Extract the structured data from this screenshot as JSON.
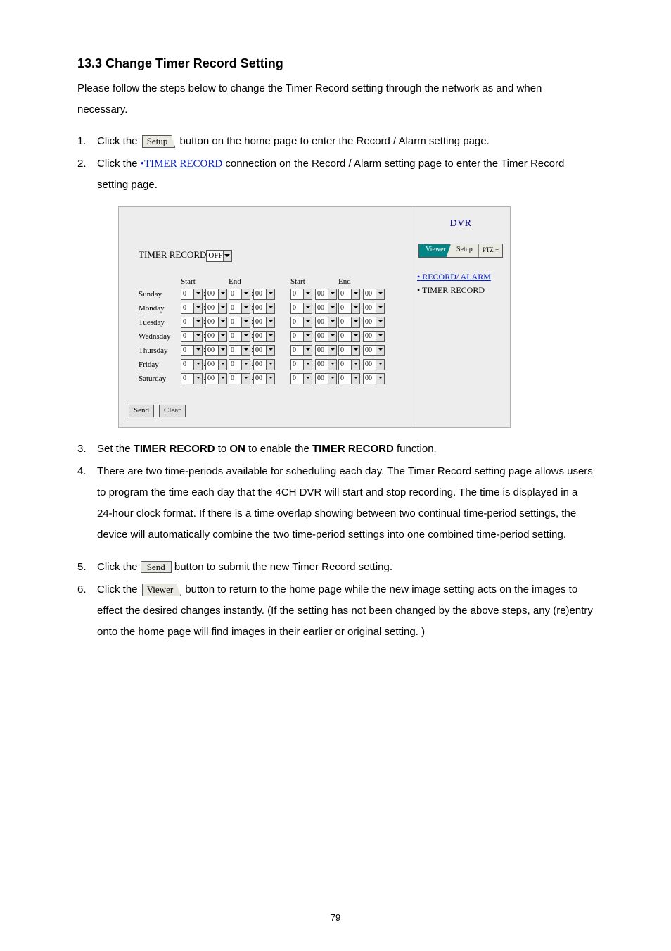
{
  "heading": "13.3 Change Timer Record Setting",
  "intro": "Please follow the steps below to change the Timer Record setting through the network as and when necessary.",
  "steps": {
    "s1a": "Click the ",
    "setup_label": "Setup",
    "s1b": " button on the home page to enter the Record / Alarm setting page.",
    "s2a": "Click the ",
    "timer_link": "•TIMER RECORD",
    "s2b": " connection on the Record / Alarm setting page to enter the Timer Record setting page.",
    "s3a": "Set the ",
    "s3b": "TIMER RECORD",
    "s3c": " to ",
    "s3d": "ON",
    "s3e": " to enable the ",
    "s3f": "TIMER RECORD",
    "s3g": " function.",
    "s4": "There are two time-periods available for scheduling each day. The Timer Record setting page allows users to program the time each day that the 4CH DVR will start and stop recording. The time is displayed in a 24-hour clock format. If there is a time overlap showing between two continual time-period settings, the device will automatically combine the two time-period settings into one combined time-period setting.",
    "s5a": "Click the ",
    "send_label": "Send",
    "s5b": " button to submit the new Timer Record setting.",
    "s6a": "Click the ",
    "viewer_label": "Viewer",
    "s6b": " button to return to the home page while the new image setting acts on the images to effect the desired changes instantly. (If the setting has not been changed by the above steps, any (re)entry onto the home page will find images in their earlier or original setting. )"
  },
  "shot": {
    "brand": "DVR",
    "tab_viewer": "Viewer",
    "tab_setup": "Setup",
    "tab_ptz": "PTZ +",
    "nav1": "• RECORD/ ALARM",
    "nav2": "• TIMER RECORD",
    "title": "TIMER RECORD",
    "title_dd": "OFF",
    "col_start": "Start",
    "col_end": "End",
    "days": [
      "Sunday",
      "Monday",
      "Tuesday",
      "Wednsday",
      "Thursday",
      "Friday",
      "Saturday"
    ],
    "hour": "0",
    "min": "00",
    "btn_send": "Send",
    "btn_clear": "Clear"
  },
  "page_number": "79"
}
